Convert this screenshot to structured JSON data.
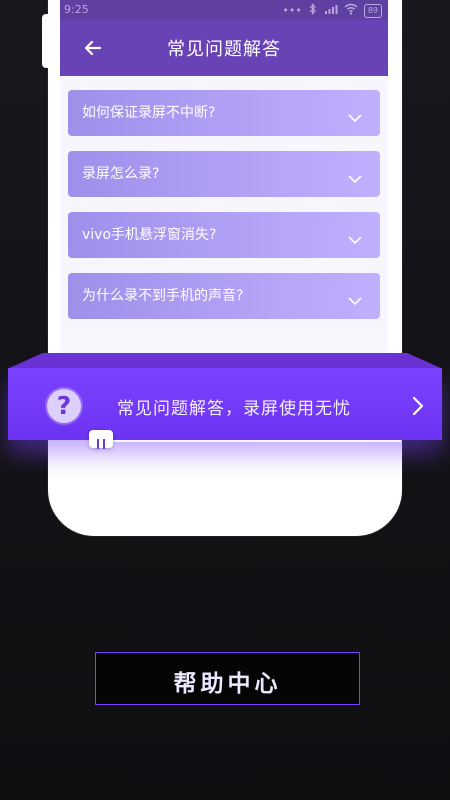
{
  "status_bar": {
    "time": "9:25",
    "dots": "•••",
    "battery": "89"
  },
  "header": {
    "title": "常见问题解答",
    "back_icon": "back-arrow-icon"
  },
  "faq": {
    "items": [
      {
        "label": "如何保证录屏不中断?",
        "icon": "chevron-down-icon"
      },
      {
        "label": "录屏怎么录?",
        "icon": "chevron-down-icon"
      },
      {
        "label": "vivo手机悬浮窗消失?",
        "icon": "chevron-down-icon"
      },
      {
        "label": "为什么录不到手机的声音?",
        "icon": "chevron-down-icon"
      }
    ]
  },
  "banner": {
    "icon": "question-icon",
    "icon_glyph": "?",
    "text": "常见问题解答，录屏使用无忧",
    "arrow_icon": "chevron-right-icon"
  },
  "help_center": {
    "label": "帮助中心"
  },
  "colors": {
    "background": "#131216",
    "header": "#6743b6",
    "faq_gradient_start": "#9e8fea",
    "faq_gradient_end": "#c1afff",
    "banner": "#7a42ff",
    "button_border": "#7a42ff"
  }
}
